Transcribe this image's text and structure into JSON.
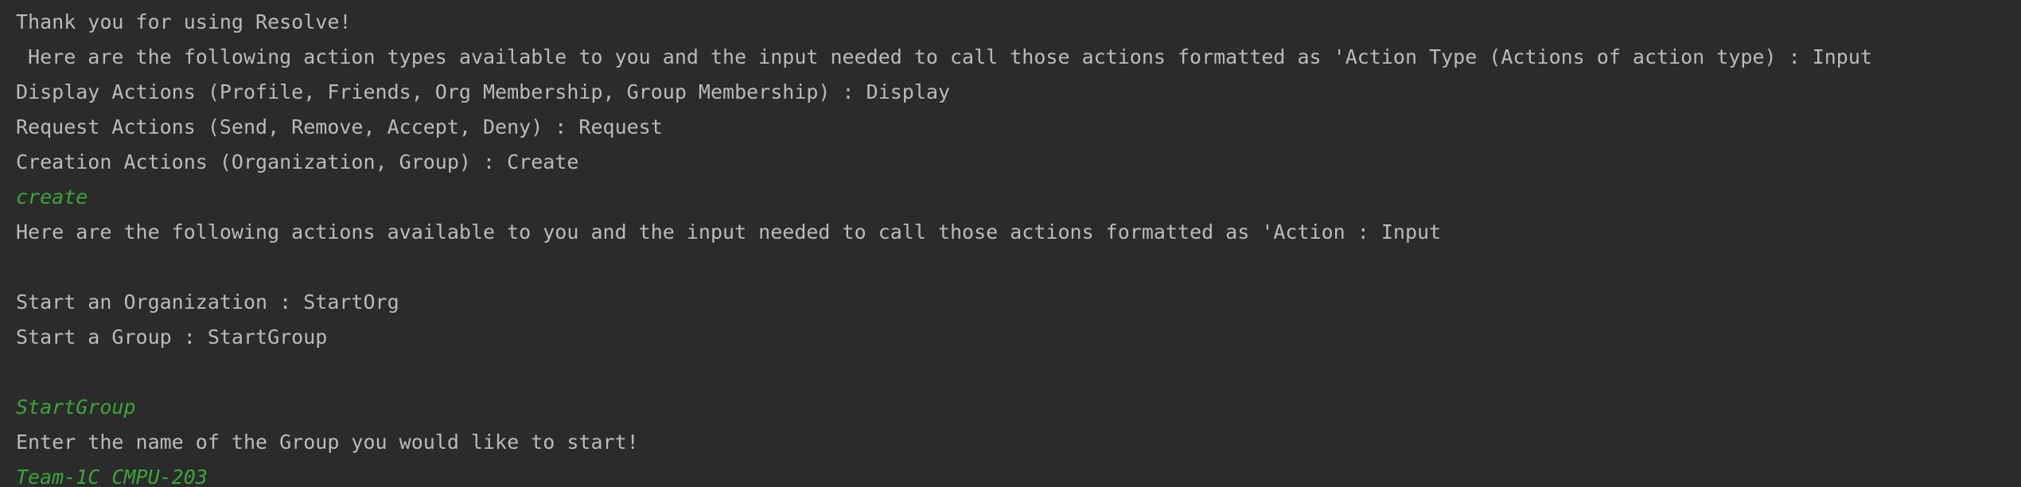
{
  "console": {
    "lines": [
      {
        "text": "Thank you for using Resolve!",
        "kind": "output"
      },
      {
        "text": " Here are the following action types available to you and the input needed to call those actions formatted as 'Action Type (Actions of action type) : Input",
        "kind": "output"
      },
      {
        "text": "Display Actions (Profile, Friends, Org Membership, Group Membership) : Display",
        "kind": "output"
      },
      {
        "text": "Request Actions (Send, Remove, Accept, Deny) : Request",
        "kind": "output"
      },
      {
        "text": "Creation Actions (Organization, Group) : Create",
        "kind": "output"
      },
      {
        "text": "create",
        "kind": "input"
      },
      {
        "text": "Here are the following actions available to you and the input needed to call those actions formatted as 'Action : Input",
        "kind": "output"
      },
      {
        "text": "",
        "kind": "empty"
      },
      {
        "text": "Start an Organization : StartOrg",
        "kind": "output"
      },
      {
        "text": "Start a Group : StartGroup",
        "kind": "output"
      },
      {
        "text": "",
        "kind": "empty"
      },
      {
        "text": "StartGroup",
        "kind": "input"
      },
      {
        "text": "Enter the name of the Group you would like to start!",
        "kind": "output"
      },
      {
        "text": "Team-1C CMPU-203",
        "kind": "input"
      }
    ]
  },
  "colors": {
    "background": "#2b2b2b",
    "output_text": "#bbbbbb",
    "input_text": "#3aa63a"
  }
}
